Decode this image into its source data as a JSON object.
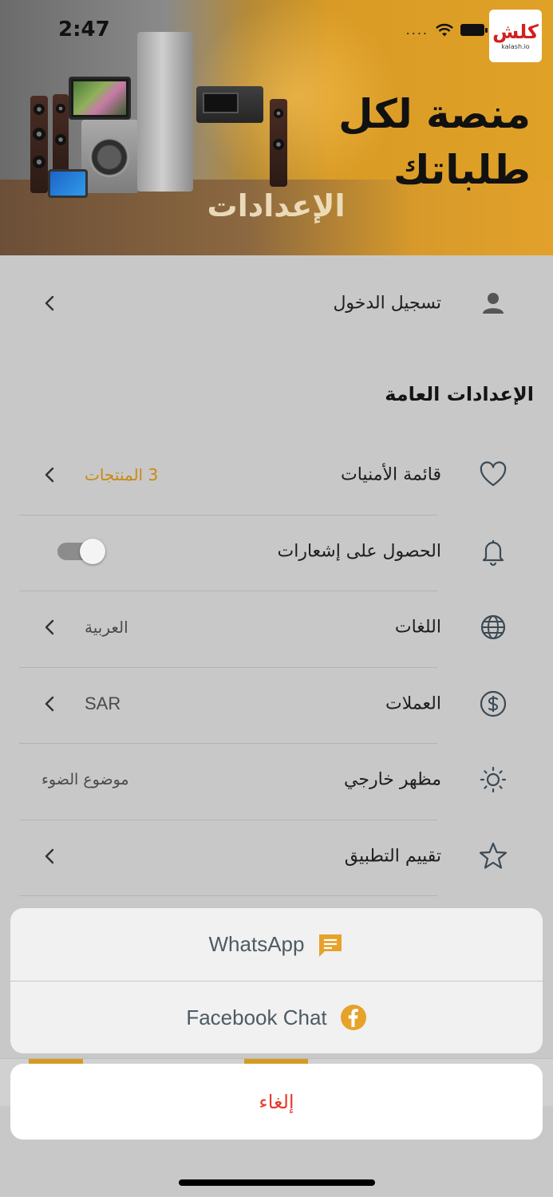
{
  "status_bar": {
    "time": "2:47",
    "signal_text": "...."
  },
  "hero": {
    "logo_text": "كلش",
    "logo_domain": "kalash.io",
    "tagline_line1": "منصة لكل",
    "tagline_line2": "طلباتك",
    "page_title": "الإعدادات"
  },
  "login": {
    "label": "تسجيل الدخول",
    "icon": "person-icon"
  },
  "general_section": {
    "title": "الإعدادات العامة",
    "items": [
      {
        "label": "قائمة الأمنيات",
        "value": "3 المنتجات",
        "icon": "heart-icon"
      },
      {
        "label": "الحصول على إشعارات",
        "toggle_on": true,
        "icon": "bell-icon"
      },
      {
        "label": "اللغات",
        "value": "العربية",
        "icon": "globe-icon"
      },
      {
        "label": "العملات",
        "value": "SAR",
        "icon": "dollar-icon"
      },
      {
        "label": "مظهر خارجي",
        "value": "موضوع الضوء",
        "icon": "sun-icon"
      },
      {
        "label": "تقييم التطبيق",
        "icon": "star-icon"
      }
    ]
  },
  "action_sheet": {
    "options": [
      {
        "label": "WhatsApp",
        "icon": "chat-icon"
      },
      {
        "label": "Facebook Chat",
        "icon": "facebook-icon"
      }
    ],
    "cancel_label": "إلغاء"
  },
  "colors": {
    "accent": "#D59A20",
    "cancel": "#E53A2A",
    "sheet_text": "#4D5B63"
  }
}
